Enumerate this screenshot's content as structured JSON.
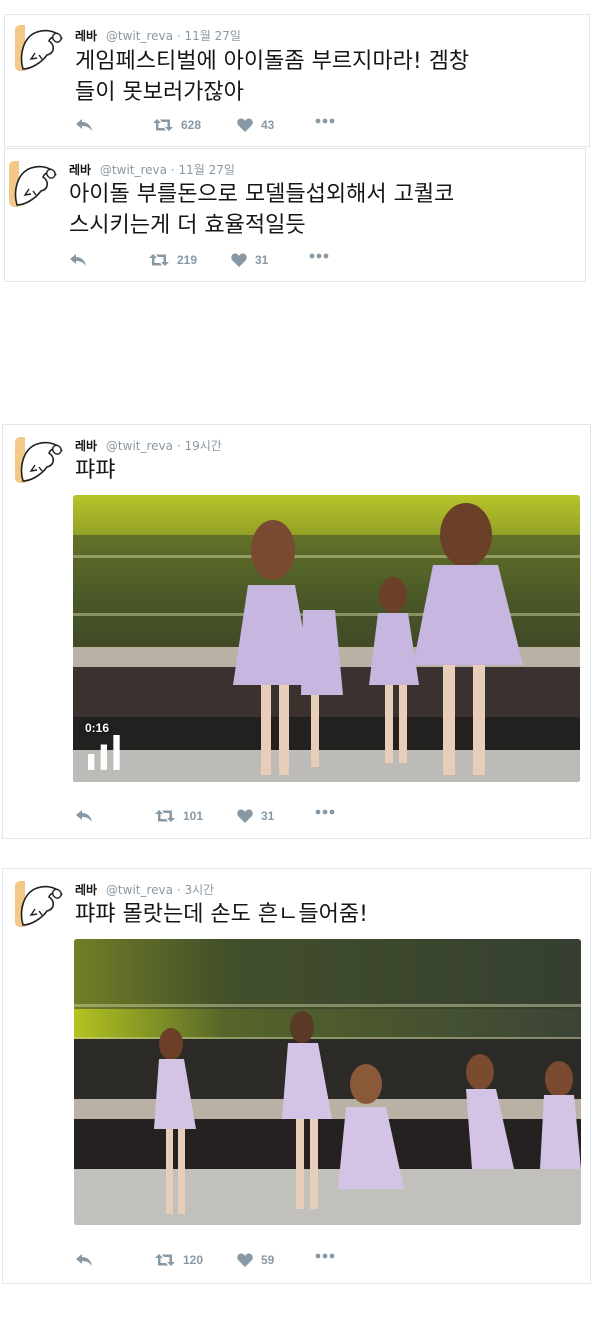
{
  "tweets": [
    {
      "name": "레바",
      "handle": "@twit_reva",
      "time": "11월 27일",
      "text_line1": "게임페스티벌에 아이돌좀 부르지마라! 겜창",
      "text_line2": "들이 못보러가잖아",
      "retweets": "628",
      "likes": "43"
    },
    {
      "name": "레바",
      "handle": "@twit_reva",
      "time": "11월 27일",
      "text_line1": "아이돌 부를돈으로 모델들섭외해서 고퀄코",
      "text_line2": "스시키는게 더 효율적일듯",
      "retweets": "219",
      "likes": "31"
    },
    {
      "name": "레바",
      "handle": "@twit_reva",
      "time": "19시간",
      "text_line1": "퍄퍄",
      "video_time": "0:16",
      "retweets": "101",
      "likes": "31"
    },
    {
      "name": "레바",
      "handle": "@twit_reva",
      "time": "3시간",
      "text_line1": "퍄퍄 몰랏는데 손도 흔ㄴ들어줌!",
      "retweets": "120",
      "likes": "59"
    }
  ],
  "icons": {
    "reply": "reply-icon",
    "retweet": "retweet-icon",
    "like": "heart-icon",
    "more": "more-icon",
    "video": "volume-bars-icon"
  },
  "colors": {
    "icon": "#8899a6",
    "border": "#e1e8ed",
    "text": "#14171a",
    "stage_green": "#9bb81a",
    "dress": "#c7b6e0"
  }
}
